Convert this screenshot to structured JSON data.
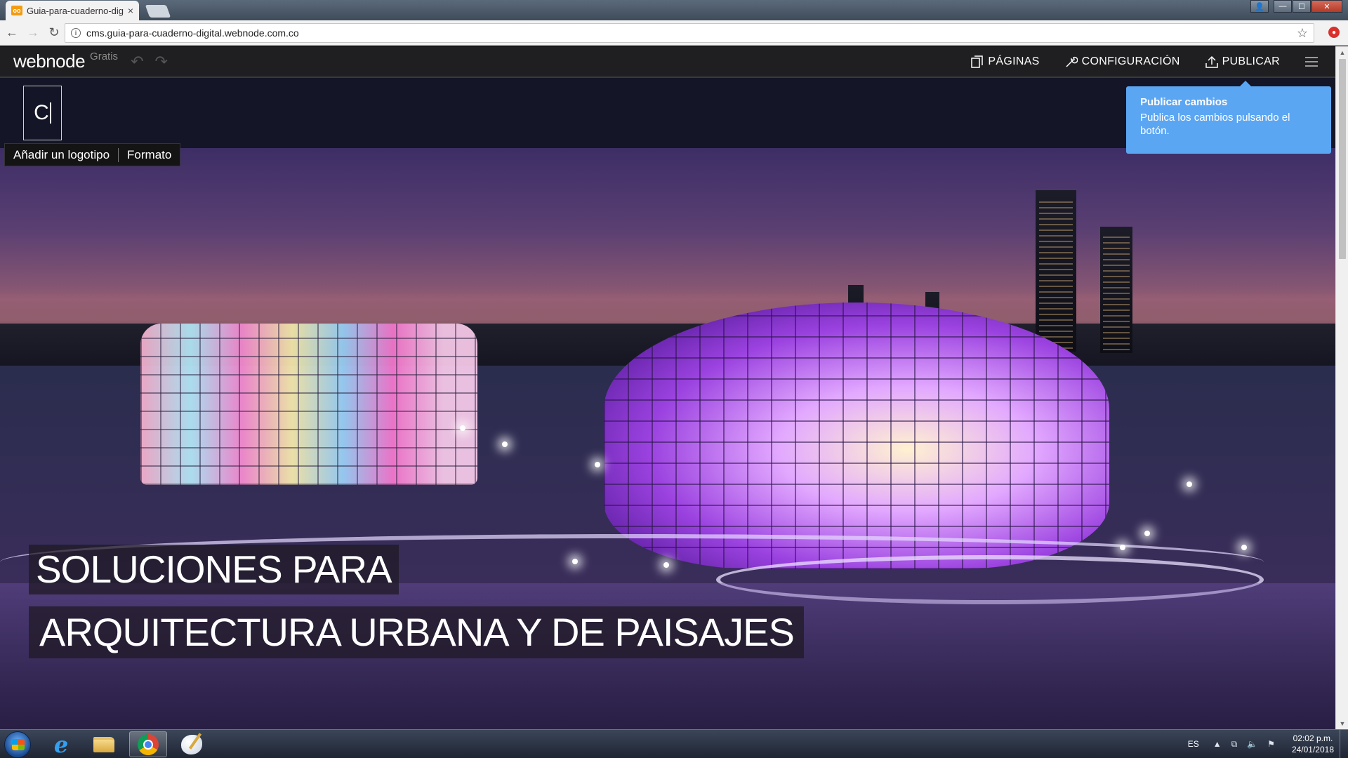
{
  "browser": {
    "tab_title": "Guia-para-cuaderno-dig",
    "tab_close": "×",
    "favicon_text": "oo",
    "url": "cms.guia-para-cuaderno-digital.webnode.com.co",
    "info_icon": "i",
    "back": "←",
    "forward": "→",
    "reload": "↻",
    "star": "☆",
    "extension_icon": "●",
    "window": {
      "user": "👤",
      "minimize": "—",
      "maximize": "☐",
      "close": "✕"
    }
  },
  "editor": {
    "logo": "webnode",
    "plan": "Gratis",
    "undo": "↶",
    "redo": "↷",
    "menu": {
      "pages": "PÁGINAS",
      "settings": "CONFIGURACIÓN",
      "publish": "PUBLICAR"
    }
  },
  "site": {
    "logo_text": "C",
    "logo_toolbar": {
      "add_logo": "Añadir un logotipo",
      "format": "Formato"
    },
    "hero_line1": "SOLUCIONES PARA",
    "hero_line2": "ARQUITECTURA URBANA Y DE PAISAJES"
  },
  "tooltip": {
    "title": "Publicar cambios",
    "body": "Publica los cambios pulsando el botón."
  },
  "scrollbar": {
    "up": "▲",
    "down": "▼"
  },
  "taskbar": {
    "ie_label": "e",
    "lang": "ES",
    "tray_symbols": [
      "▲",
      "⧉",
      "🔈",
      "⚑"
    ],
    "time": "02:02 p.m.",
    "date": "24/01/2018"
  },
  "colors": {
    "editor_bar": "#1f1f21",
    "tooltip": "#5ba6f3",
    "site_header": "#141526"
  }
}
